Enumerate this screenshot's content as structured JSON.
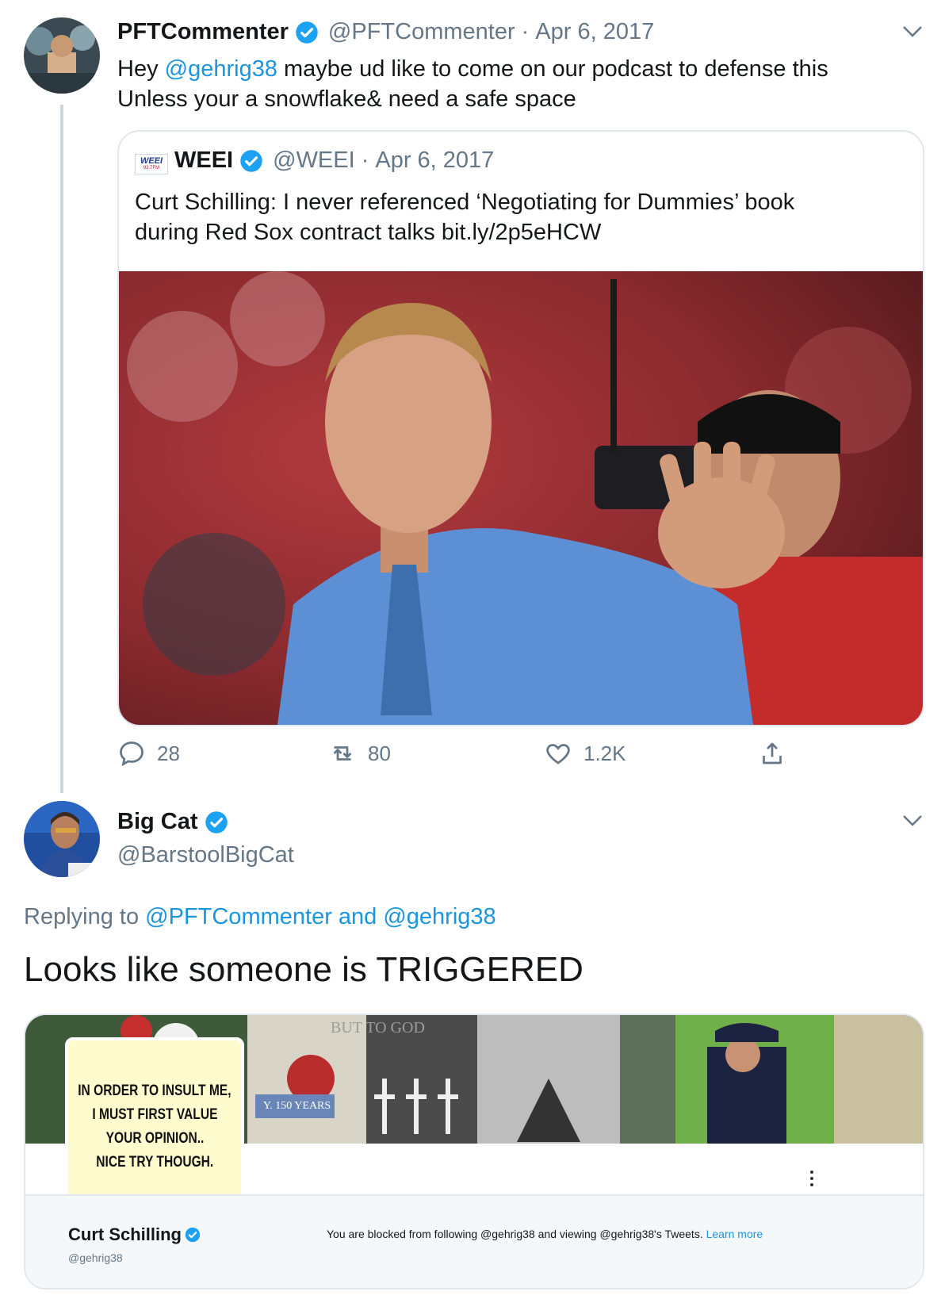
{
  "colors": {
    "accent": "#1b95e0",
    "secondary_text": "#657786",
    "border": "#e1e8ed"
  },
  "tweet1": {
    "display_name": "PFTCommenter",
    "handle": "@PFTCommenter",
    "separator": "·",
    "date": "Apr 6, 2017",
    "text_prefix": "Hey ",
    "mention": "@gehrig38",
    "text_rest": " maybe ud like to come on our podcast to defense this",
    "text_line2": "Unless your a snowflake& need a safe space",
    "quote": {
      "logo_top": "WEEI",
      "logo_bottom": "93.7FM",
      "display_name": "WEEI",
      "handle": "@WEEI",
      "separator": "·",
      "date": "Apr 6, 2017",
      "text": "Curt Schilling: I never referenced ‘Negotiating for Dummies’ book during Red Sox contract talks bit.ly/2p5eHCW",
      "photo_icon": "waving-man-photo"
    },
    "actions": {
      "reply_count": "28",
      "retweet_count": "80",
      "like_count": "1.2K"
    }
  },
  "tweet2": {
    "display_name": "Big Cat",
    "handle": "@BarstoolBigCat",
    "replying_label": "Replying to ",
    "replying_to_1": "@PFTCommenter",
    "replying_and": " and ",
    "replying_to_2": "@gehrig38",
    "text": "Looks like someone is TRIGGERED",
    "card": {
      "banner_text_1": "BUT TO GOD",
      "banner_text_2": "Y. 150 YEARS",
      "meme_lines": [
        "IN ORDER TO INSULT ME,",
        "I MUST FIRST VALUE",
        "YOUR OPINION..",
        "NICE TRY THOUGH."
      ],
      "profile_name": "Curt Schilling",
      "profile_handle": "@gehrig38",
      "blocked_text": "You are blocked from following @gehrig38 and viewing @gehrig38's Tweets.",
      "learn_more": "Learn more"
    }
  }
}
